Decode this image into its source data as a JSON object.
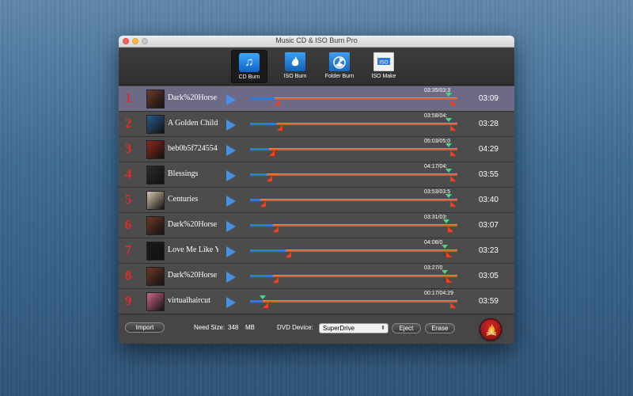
{
  "window": {
    "title": "Music CD & ISO Burn Pro"
  },
  "toolbar": {
    "items": [
      {
        "label": "CD Burn",
        "active": true,
        "icon": "music-note-icon"
      },
      {
        "label": "ISO Burn",
        "active": false,
        "icon": "flame-disc-icon"
      },
      {
        "label": "Folder Burn",
        "active": false,
        "icon": "folder-burn-icon"
      },
      {
        "label": "ISO Make",
        "active": false,
        "icon": "iso-file-icon"
      }
    ]
  },
  "tracks": [
    {
      "num": "1",
      "name": "Dark%20Horse",
      "span": "03:35/03:3",
      "duration": "03:09",
      "progress": 0.12,
      "start": 0.12,
      "end": 0.98,
      "selected": true,
      "thumb": "#6b3a2a"
    },
    {
      "num": "2",
      "name": "A Golden Child",
      "span": "03:58/04:",
      "duration": "03:28",
      "progress": 0.13,
      "start": 0.13,
      "end": 0.98,
      "selected": false,
      "thumb": "#2a5a8a"
    },
    {
      "num": "3",
      "name": "beb0b5f724554",
      "span": "05:03/05:0",
      "duration": "04:29",
      "progress": 0.09,
      "start": 0.09,
      "end": 0.98,
      "selected": false,
      "thumb": "#8a2a1a"
    },
    {
      "num": "4",
      "name": "Blessings",
      "span": "04:17/04:",
      "duration": "03:55",
      "progress": 0.08,
      "start": 0.08,
      "end": 0.98,
      "selected": false,
      "thumb": "#2a2a2a"
    },
    {
      "num": "5",
      "name": "Centuries",
      "span": "03:53/03:5",
      "duration": "03:40",
      "progress": 0.05,
      "start": 0.05,
      "end": 0.98,
      "selected": false,
      "thumb": "#d8c8b0"
    },
    {
      "num": "6",
      "name": "Dark%20Horse",
      "span": "03:31/03:",
      "duration": "03:07",
      "progress": 0.11,
      "start": 0.11,
      "end": 0.97,
      "selected": false,
      "thumb": "#6b3a2a"
    },
    {
      "num": "7",
      "name": "Love Me Like You",
      "span": "04:08/0",
      "duration": "03:23",
      "progress": 0.17,
      "start": 0.17,
      "end": 0.96,
      "selected": false,
      "thumb": "#1a1a1a"
    },
    {
      "num": "8",
      "name": "Dark%20Horse",
      "span": "03:27/0",
      "duration": "03:05",
      "progress": 0.11,
      "start": 0.11,
      "end": 0.96,
      "selected": false,
      "thumb": "#6b3a2a"
    },
    {
      "num": "9",
      "name": "virtualhaircut",
      "span": "00:17/04:29",
      "duration": "03:59",
      "progress": 0.06,
      "start": 0.06,
      "end": 0.98,
      "selected": false,
      "thumb": "#c86a8a"
    }
  ],
  "footer": {
    "import_label": "Import",
    "need_size_label": "Need Size:",
    "need_size_value": "348",
    "need_size_unit": "MB",
    "device_label": "DVD Device:",
    "device_value": "SuperDrive",
    "eject_label": "Eject",
    "erase_label": "Erase"
  },
  "colors": {
    "track_number": "#e02b2b",
    "progress_fill": "#2b7be0",
    "track_bar": "#e05a1a",
    "marker": "#ff3a1a",
    "marker_green": "#3ee07a",
    "selected_row": "#6c6a85"
  }
}
